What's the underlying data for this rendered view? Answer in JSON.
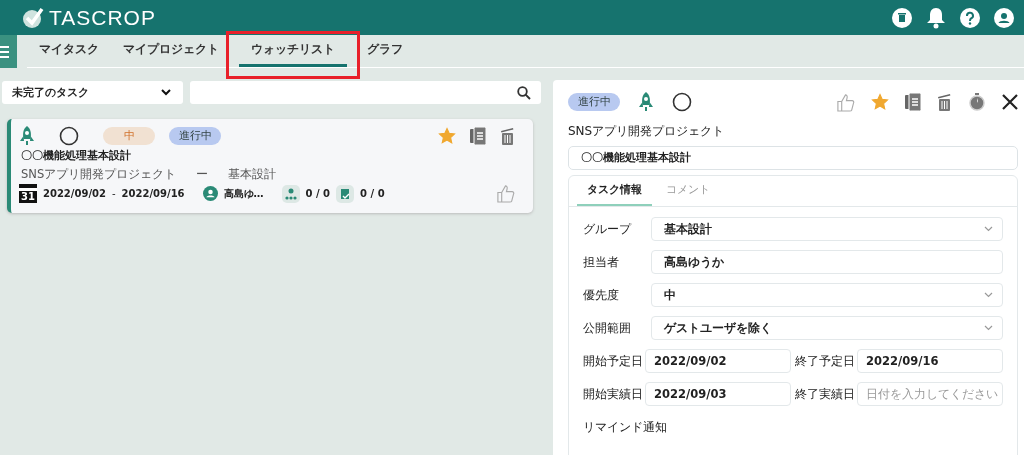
{
  "header": {
    "logo": "TASCROP"
  },
  "nav": {
    "tabs": [
      {
        "label": "マイタスク",
        "selected": false
      },
      {
        "label": "マイプロジェクト",
        "selected": false
      },
      {
        "label": "ウォッチリスト",
        "selected": true,
        "highlighted": true
      },
      {
        "label": "グラフ",
        "selected": false
      }
    ]
  },
  "filter": {
    "value": "未完了のタスク"
  },
  "tasks": [
    {
      "completed": false,
      "priority": "中",
      "status": "進行中",
      "starred": true,
      "liked": false,
      "title": "〇〇機能処理基本設計",
      "project": "SNSアプリ開発プロジェクト",
      "separator": "ー",
      "group": "基本設計",
      "calendar_day": "31",
      "start": "2022/09/02",
      "dash": "-",
      "end": "2022/09/16",
      "assignee": "高島ゆ…",
      "subtasks": "0 / 0",
      "checklist": "0 / 0"
    }
  ],
  "detail": {
    "status": "進行中",
    "completed": false,
    "liked": false,
    "starred": true,
    "project": "SNSアプリ開発プロジェクト",
    "title": "〇〇機能処理基本設計",
    "tabs": [
      {
        "label": "タスク情報",
        "selected": true
      },
      {
        "label": "コメント",
        "selected": false
      }
    ],
    "fields": [
      {
        "kind": "select",
        "label": "グループ",
        "value": "基本設計"
      },
      {
        "kind": "input",
        "label": "担当者",
        "value": "高島ゆうか"
      },
      {
        "kind": "select",
        "label": "優先度",
        "value": "中"
      },
      {
        "kind": "select",
        "label": "公開範囲",
        "value": "ゲストユーザを除く"
      },
      {
        "kind": "dates",
        "items": [
          {
            "label": "開始予定日",
            "value": "2022/09/02"
          },
          {
            "label": "終了予定日",
            "value": "2022/09/16"
          }
        ]
      },
      {
        "kind": "dates",
        "items": [
          {
            "label": "開始実績日",
            "value": "2022/09/03"
          },
          {
            "label": "終了実績日",
            "placeholder": "日付を入力してください"
          }
        ]
      },
      {
        "kind": "heading",
        "label": "リマインド通知"
      }
    ]
  }
}
